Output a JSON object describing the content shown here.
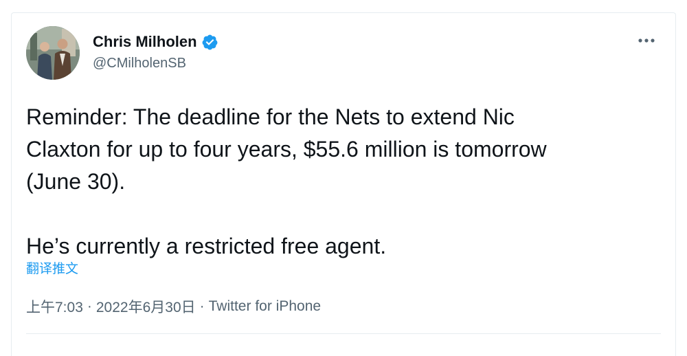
{
  "author": {
    "display_name": "Chris Milholen",
    "handle": "@CMilholenSB",
    "verified": true
  },
  "tweet": {
    "text": "Reminder: The deadline for the Nets to extend Nic\nClaxton for up to four years, $55.6 million is tomorrow\n(June 30).\n\nHe’s currently a restricted free agent.",
    "translate_label": "翻译推文"
  },
  "meta": {
    "time": "上午7:03",
    "date": "2022年6月30日",
    "separator": "·",
    "source": "Twitter for iPhone"
  },
  "icons": {
    "more": "more-horizontal-icon",
    "verified": "verified-badge-icon"
  },
  "colors": {
    "accent": "#1d9bf0",
    "secondary_text": "#536471",
    "primary_text": "#0f1419"
  }
}
